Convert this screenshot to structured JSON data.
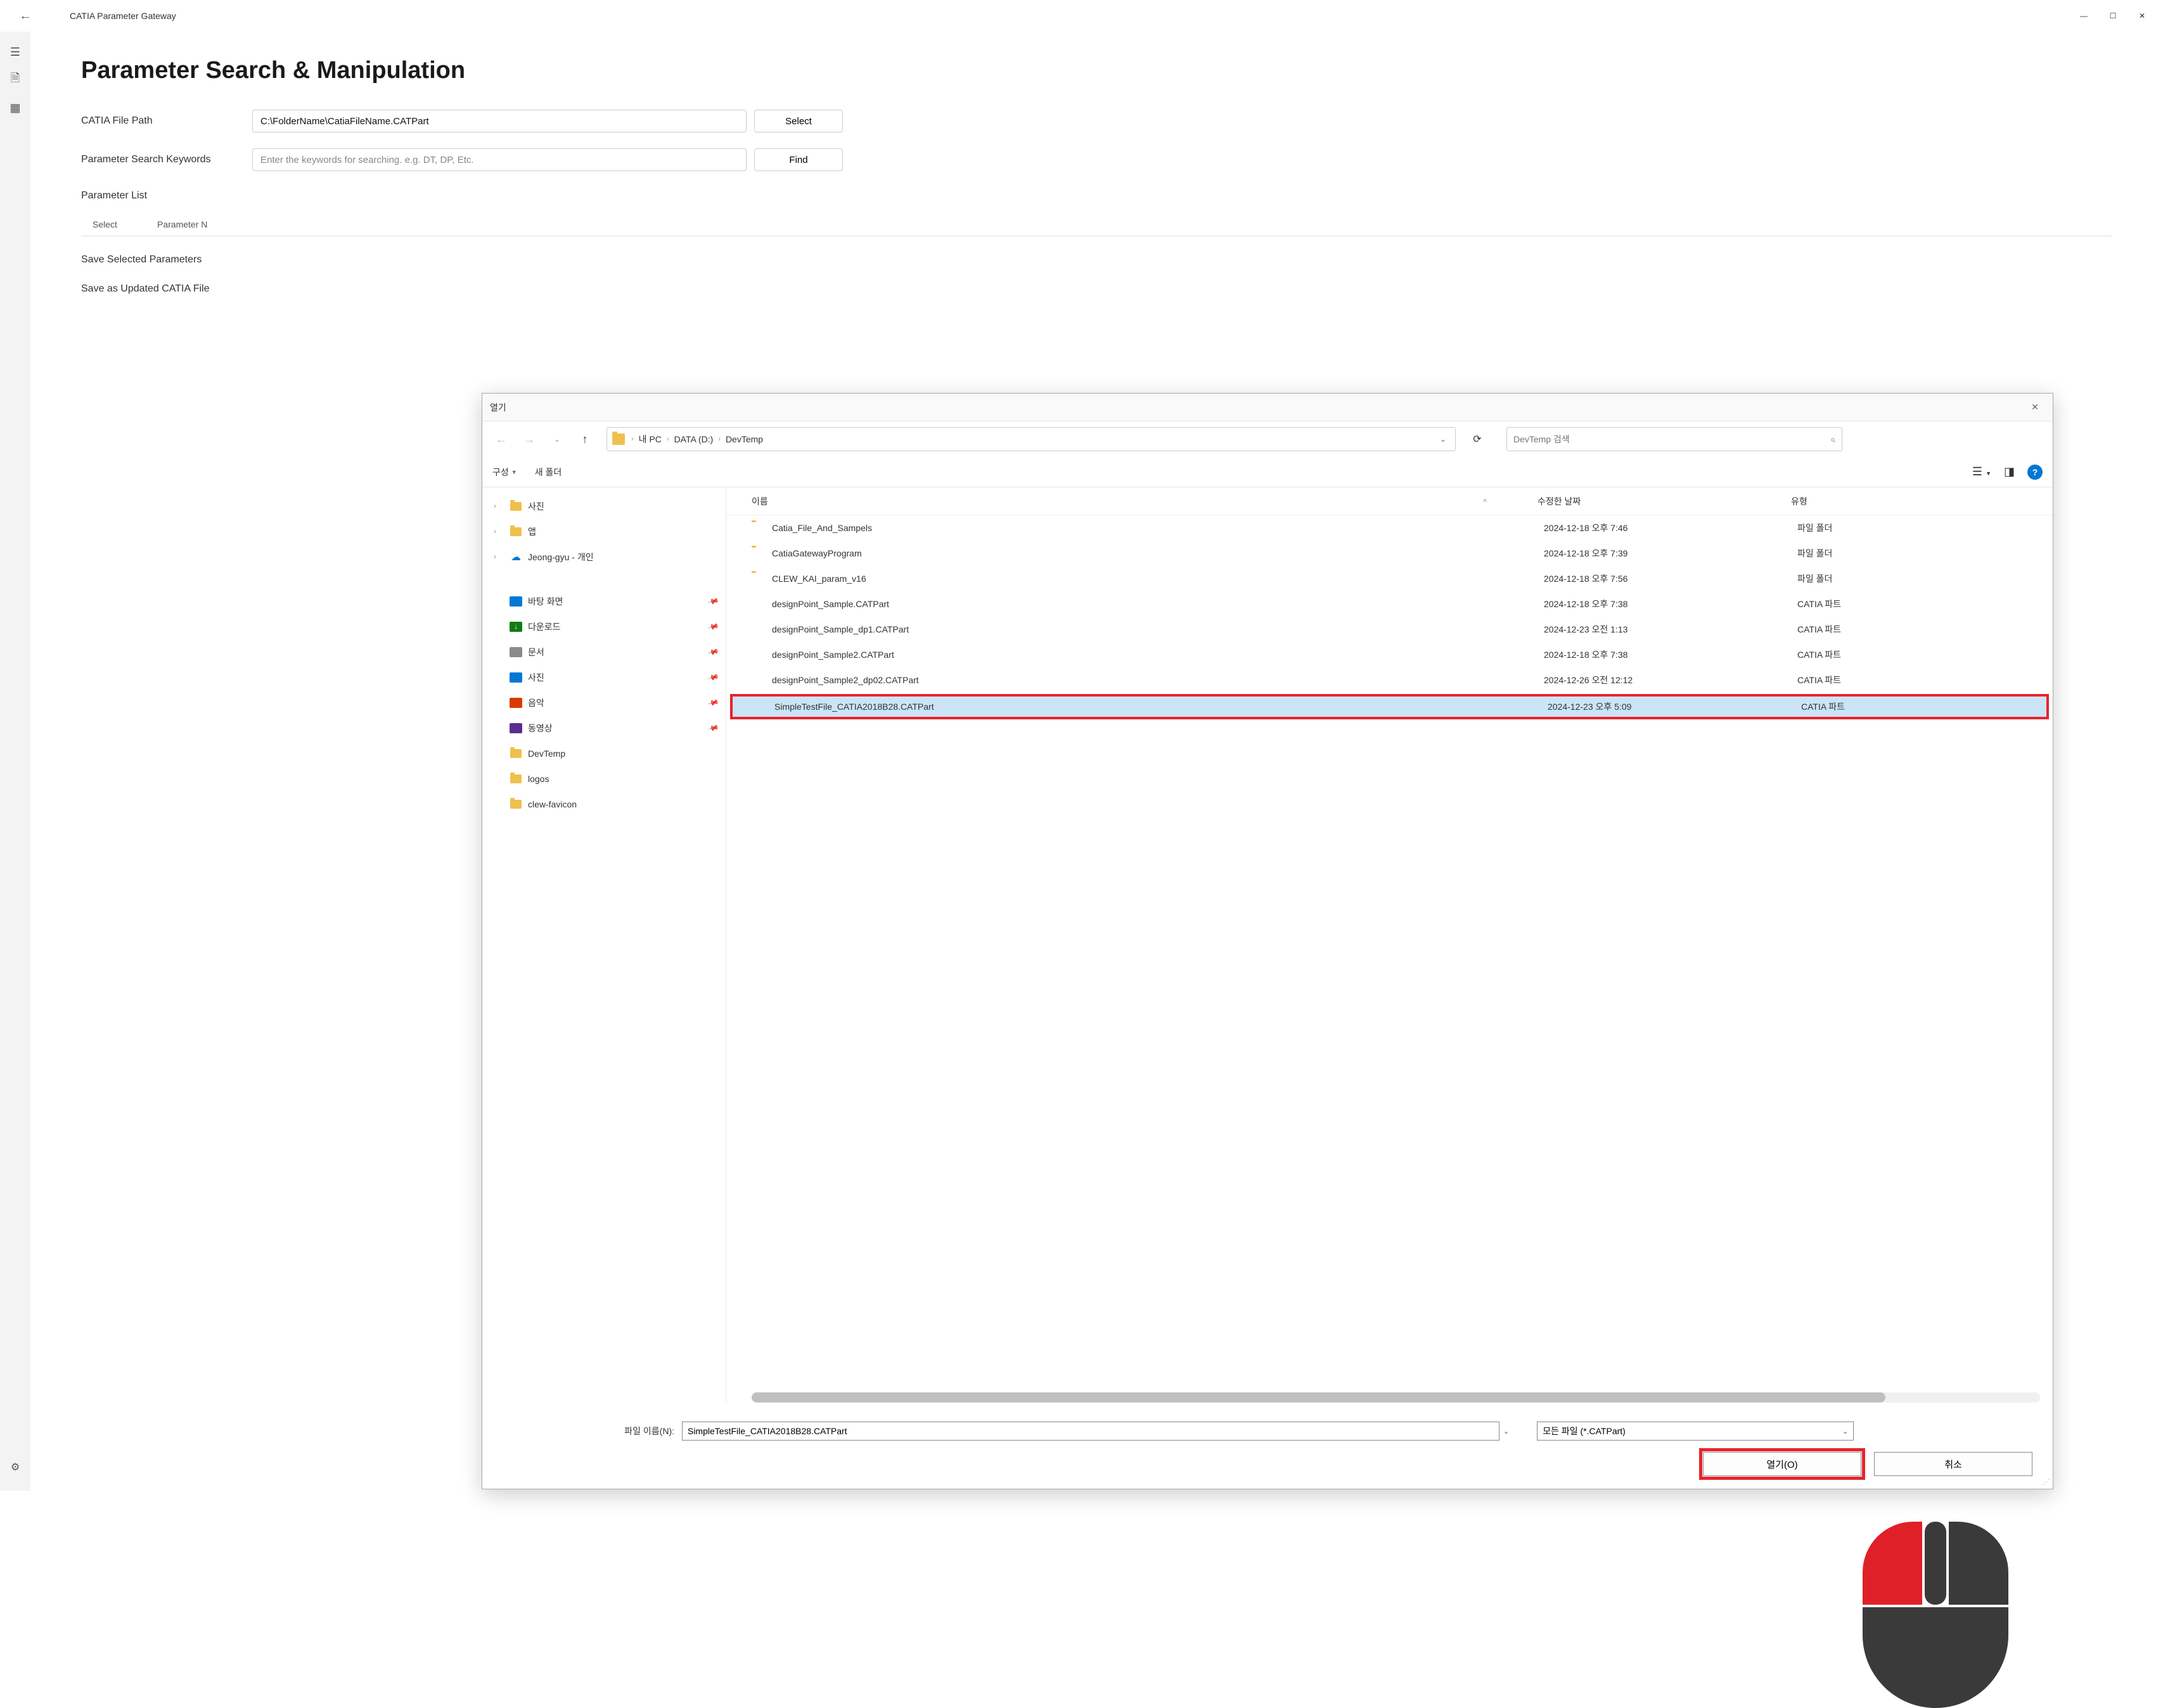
{
  "titlebar": {
    "title": "CATIA Parameter Gateway"
  },
  "page": {
    "heading": "Parameter Search & Manipulation",
    "file_path_label": "CATIA File Path",
    "file_path_value": "C:\\FolderName\\CatiaFileName.CATPart",
    "select_button": "Select",
    "keywords_label": "Parameter Search Keywords",
    "keywords_placeholder": "Enter the keywords for searching. e.g. DT, DP, Etc.",
    "find_button": "Find",
    "parameter_list_label": "Parameter List",
    "col_select": "Select",
    "col_param_name": "Parameter N",
    "save_selected": "Save Selected Parameters",
    "save_as": "Save as Updated CATIA File"
  },
  "dialog": {
    "title": "열기",
    "breadcrumb": [
      "내 PC",
      "DATA (D:)",
      "DevTemp"
    ],
    "search_placeholder": "DevTemp 검색",
    "toolbar": {
      "organize": "구성",
      "new_folder": "새 폴더"
    },
    "tree_top": [
      {
        "label": "사진",
        "expandable": true
      },
      {
        "label": "앱",
        "expandable": true
      },
      {
        "label": "Jeong-gyu - 개인",
        "expandable": true,
        "cloud": true
      }
    ],
    "quick_access": [
      {
        "label": "바탕 화면",
        "icon_bg": "#0078d4",
        "pinned": true
      },
      {
        "label": "다운로드",
        "icon_bg": "#107c10",
        "pinned": true,
        "glyph": "↓"
      },
      {
        "label": "문서",
        "icon_bg": "#8a8a8a",
        "pinned": true
      },
      {
        "label": "사진",
        "icon_bg": "#0078d4",
        "pinned": true
      },
      {
        "label": "음악",
        "icon_bg": "#d83b01",
        "pinned": true
      },
      {
        "label": "동영상",
        "icon_bg": "#5c2d91",
        "pinned": true
      },
      {
        "label": "DevTemp",
        "folder": true
      },
      {
        "label": "logos",
        "folder": true
      },
      {
        "label": "clew-favicon",
        "folder": true
      }
    ],
    "columns": {
      "name": "이름",
      "date": "수정한 날짜",
      "type": "유형"
    },
    "files": [
      {
        "name": "Catia_File_And_Sampels",
        "date": "2024-12-18 오후 7:46",
        "type": "파일 폴더",
        "folder": true
      },
      {
        "name": "CatiaGatewayProgram",
        "date": "2024-12-18 오후 7:39",
        "type": "파일 폴더",
        "folder": true
      },
      {
        "name": "CLEW_KAI_param_v16",
        "date": "2024-12-18 오후 7:56",
        "type": "파일 폴더",
        "folder": true
      },
      {
        "name": "designPoint_Sample.CATPart",
        "date": "2024-12-18 오후 7:38",
        "type": "CATIA 파트",
        "folder": false
      },
      {
        "name": "designPoint_Sample_dp1.CATPart",
        "date": "2024-12-23 오전 1:13",
        "type": "CATIA 파트",
        "folder": false
      },
      {
        "name": "designPoint_Sample2.CATPart",
        "date": "2024-12-18 오후 7:38",
        "type": "CATIA 파트",
        "folder": false
      },
      {
        "name": "designPoint_Sample2_dp02.CATPart",
        "date": "2024-12-26 오전 12:12",
        "type": "CATIA 파트",
        "folder": false
      },
      {
        "name": "SimpleTestFile_CATIA2018B28.CATPart",
        "date": "2024-12-23 오후 5:09",
        "type": "CATIA 파트",
        "folder": false,
        "selected": true
      }
    ],
    "footer": {
      "filename_label": "파일 이름(N):",
      "filename_value": "SimpleTestFile_CATIA2018B28.CATPart",
      "filter": "모든 파일 (*.CATPart)",
      "open": "열기(O)",
      "cancel": "취소"
    }
  }
}
